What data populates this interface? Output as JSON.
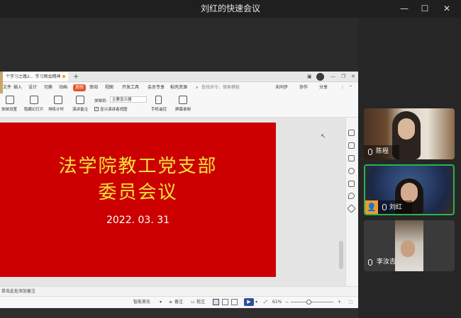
{
  "window": {
    "title": "刘红的快速会议",
    "minimize": "—",
    "maximize": "☐",
    "close": "✕"
  },
  "wps": {
    "doc_tab": "个学习之路2... 学习两会精神",
    "new_tab": "+",
    "menus": [
      "文件",
      "插入",
      "设计",
      "切换",
      "动画",
      "放映",
      "审阅",
      "视图",
      "开发工具",
      "会员专享",
      "稻壳资源"
    ],
    "search": "查找命令、搜索模板",
    "sync": "未同步",
    "collab": "协作",
    "share": "分享",
    "ribbon": [
      "放映设置",
      "隐藏幻灯片",
      "排练计时",
      "演讲备注",
      "放映到:",
      "主要显示器",
      "显示演讲者视图",
      "手机遥控",
      "屏幕录制"
    ],
    "notes_placeholder": "单击此处添加备注",
    "status": {
      "smart": "智能美化",
      "notes": "备注",
      "comment": "批注",
      "zoom": "61%"
    }
  },
  "slide": {
    "title_line1": "法学院教工党支部",
    "title_line2": "委员会议",
    "date": "2022. 03. 31"
  },
  "participants": [
    {
      "name": "陈程"
    },
    {
      "name": "刘红"
    },
    {
      "name": "李汝吉"
    }
  ],
  "colors": {
    "slide_bg": "#cc0000",
    "slide_title": "#f7e23b",
    "active_speaker_border": "#2bb24c",
    "wps_accent": "#e4542a"
  }
}
